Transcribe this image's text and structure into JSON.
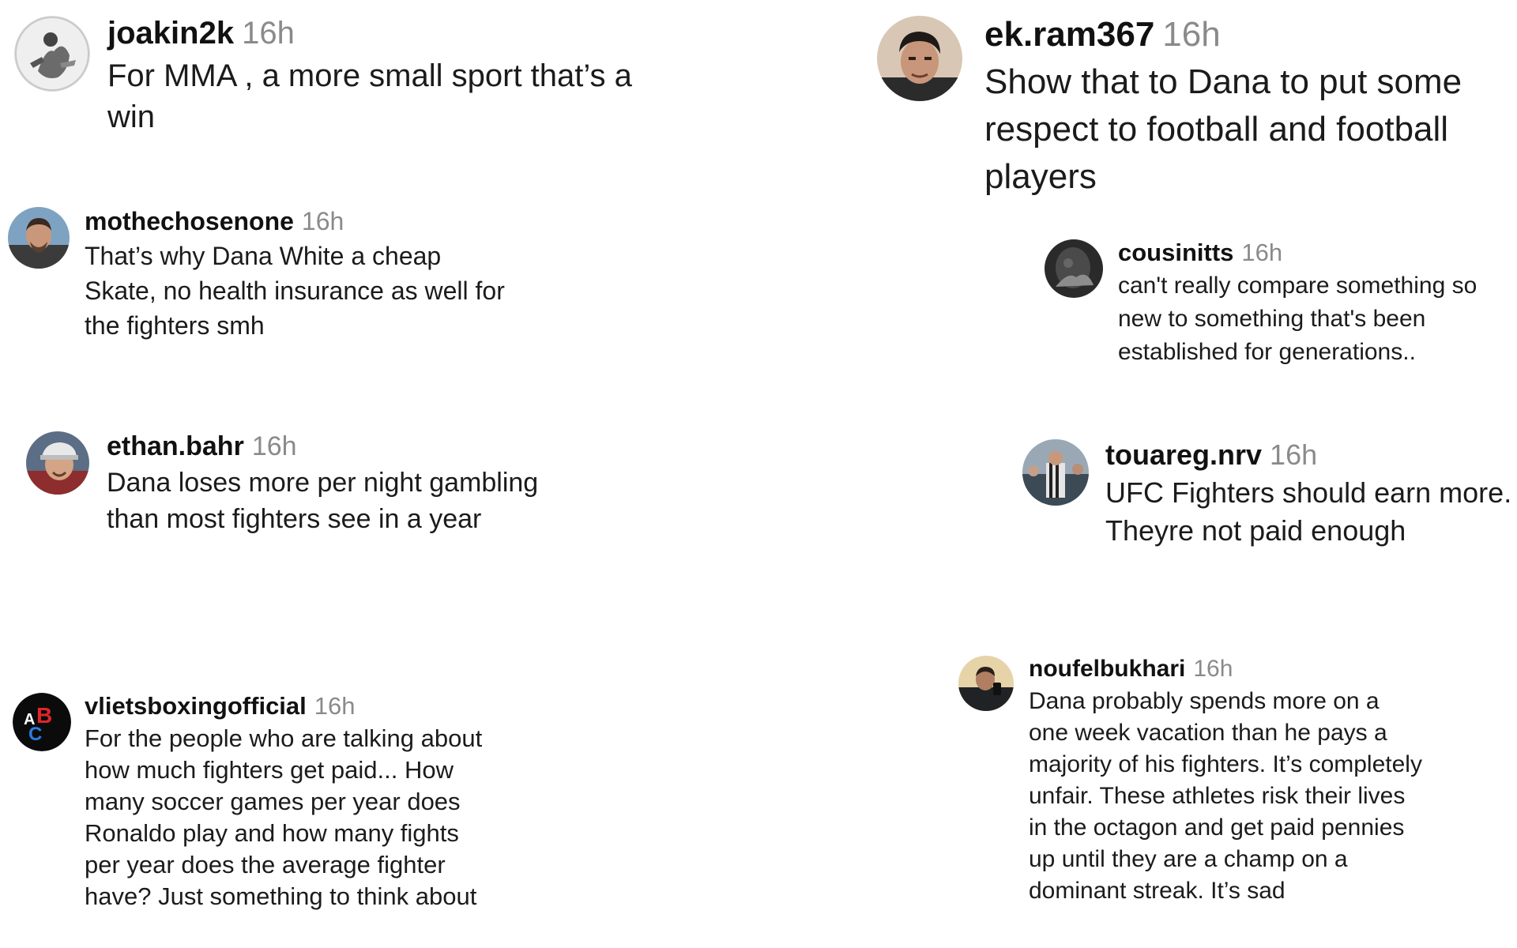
{
  "comments": [
    {
      "id": "c1",
      "username": "joakin2k",
      "time": "16h",
      "text": "For MMA , a more small sport that’s a win"
    },
    {
      "id": "c2",
      "username": "mothechosenone",
      "time": "16h",
      "text": "That’s why Dana White a cheap Skate, no health insurance as well for the fighters smh"
    },
    {
      "id": "c3",
      "username": "ethan.bahr",
      "time": "16h",
      "text": "Dana loses more per night gambling than most fighters see in a year"
    },
    {
      "id": "c4",
      "username": "vlietsboxingofficial",
      "time": "16h",
      "text": "For the people who are talking about how much fighters get paid... How many soccer games per year does Ronaldo play and how many fights per year does the average fighter have? Just something to think about"
    },
    {
      "id": "c5",
      "username": "ek.ram367",
      "time": "16h",
      "text": "Show that to Dana to put some respect to football and football players"
    },
    {
      "id": "c6",
      "username": "cousinitts",
      "time": "16h",
      "text": "can't really compare something so new to something that's been established for generations.."
    },
    {
      "id": "c7",
      "username": "touareg.nrv",
      "time": "16h",
      "text": "UFC Fighters should earn more. Theyre not paid enough"
    },
    {
      "id": "c8",
      "username": "noufelbukhari",
      "time": "16h",
      "text": "Dana probably spends more on a one week vacation than he pays a majority of his fighters. It’s completely unfair. These athletes risk their lives in the octagon and get paid pennies up until they are a champ on a dominant streak. It’s sad"
    }
  ],
  "avatars": {
    "c1": "illustrated-figure-avatar-icon",
    "c2": "man-portrait-avatar-icon",
    "c3": "man-in-cap-avatar-icon",
    "c4": "abc-logo-avatar-icon",
    "c5": "man-portrait-avatar-icon",
    "c6": "dark-photo-avatar-icon",
    "c7": "crowd-photo-avatar-icon",
    "c8": "man-selfie-avatar-icon"
  },
  "colors": {
    "username": "#111111",
    "timestamp": "#8a8a8a",
    "text": "#1b1b1b",
    "background": "#ffffff"
  }
}
